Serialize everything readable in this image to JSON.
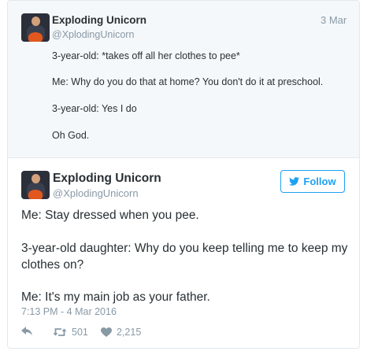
{
  "quoted_tweet": {
    "author_name": "Exploding Unicorn",
    "author_handle": "@XplodingUnicorn",
    "date": "3 Mar",
    "lines": [
      "3-year-old: *takes off all her clothes to pee*",
      "Me: Why do you do that at home? You don't do it at preschool.",
      "3-year-old: Yes I do",
      "Oh God."
    ]
  },
  "main_tweet": {
    "author_name": "Exploding Unicorn",
    "author_handle": "@XplodingUnicorn",
    "follow_label": "Follow",
    "lines": [
      "Me: Stay dressed when you pee.",
      "3-year-old daughter: Why do you keep telling me to keep my",
      "clothes on?",
      "Me: It's my main job as your father."
    ],
    "timestamp": "7:13 PM - 4 Mar 2016",
    "retweet_count": "501",
    "like_count": "2,215"
  },
  "icons": {
    "reply": "reply-icon",
    "retweet": "retweet-icon",
    "like": "heart-icon",
    "follow_bird": "twitter-bird-icon"
  },
  "colors": {
    "accent": "#1da1f2",
    "muted": "#8899a6",
    "quoted_background": "#f5f8fa",
    "text": "#292f33"
  }
}
